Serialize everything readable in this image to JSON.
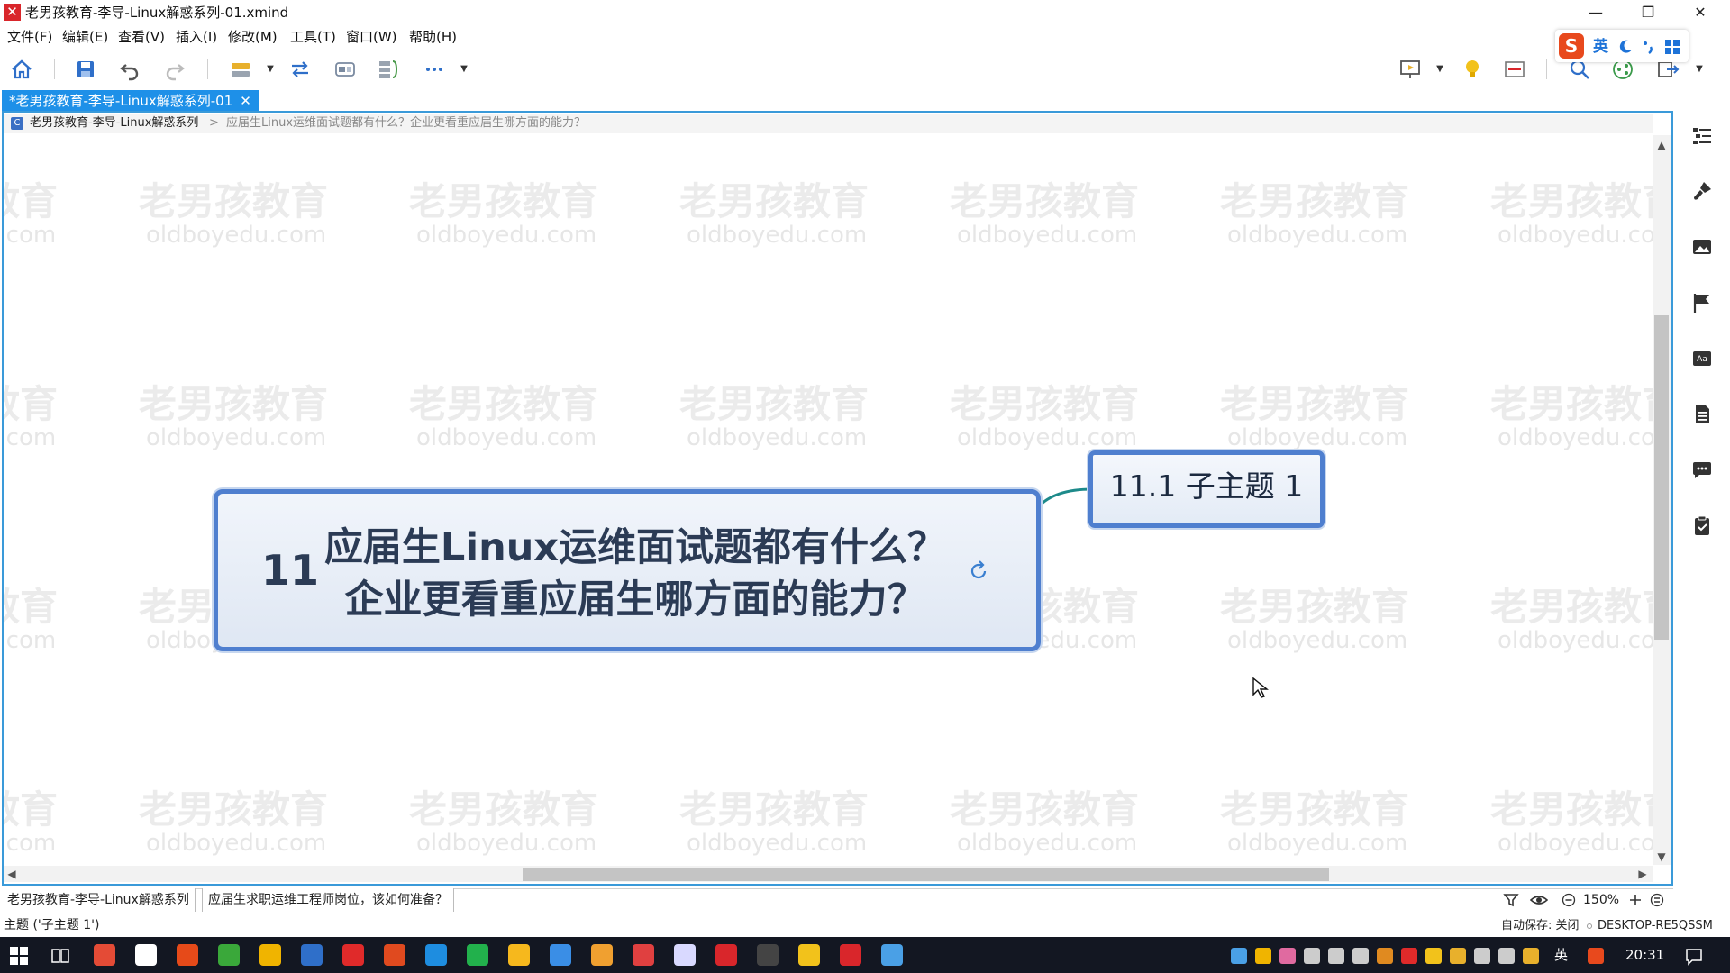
{
  "window": {
    "title": "老男孩教育-李导-Linux解惑系列-01.xmind",
    "logo": "✕",
    "minimize": "—",
    "maximize": "❐",
    "close": "✕"
  },
  "menu": [
    "文件(F)",
    "编辑(E)",
    "查看(V)",
    "插入(I)",
    "修改(M)",
    "工具(T)",
    "窗口(W)",
    "帮助(H)"
  ],
  "toolbar": {
    "icons": [
      "home-icon",
      "save-icon",
      "undo-icon",
      "redo-icon",
      "topic-icon",
      "relationship-icon",
      "boundary-icon",
      "summary-icon",
      "more-icon",
      "presentation-icon",
      "lightbulb-icon",
      "panel-icon",
      "search-icon",
      "share-icon",
      "export-icon"
    ]
  },
  "ime": {
    "lang": "英",
    "brand": "S"
  },
  "tab": {
    "label": "*老男孩教育-李导-Linux解惑系列-01",
    "close": "✕"
  },
  "breadcrumb": {
    "root": "老男孩教育-李导-Linux解惑系列",
    "separator": ">",
    "current": "应届生Linux运维面试题都有什么？企业更看重应届生哪方面的能力？"
  },
  "watermark": {
    "cn": "老男孩教育",
    "en": "oldboyedu.com"
  },
  "mindmap": {
    "central": {
      "number": "11",
      "line1": "应届生Linux运维面试题都有什么？",
      "line2": "企业更看重应届生哪方面的能力？"
    },
    "subtopic": {
      "label": "11.1 子主题 1"
    },
    "colors": {
      "border": "#4f7fcf",
      "connector": "#1d8a8a",
      "text": "#2b3b55"
    }
  },
  "sheets": [
    "老男孩教育-李导-Linux解惑系列",
    "应届生求职运维工程师岗位，该如何准备？"
  ],
  "zoom": {
    "label": "150%"
  },
  "status": {
    "selection": "主题 ('子主题 1')",
    "autosave": "自动保存: 关闭",
    "host": "DESKTOP-RE5QSSM"
  },
  "taskbar": {
    "clock": "20:31",
    "lang": "英"
  }
}
